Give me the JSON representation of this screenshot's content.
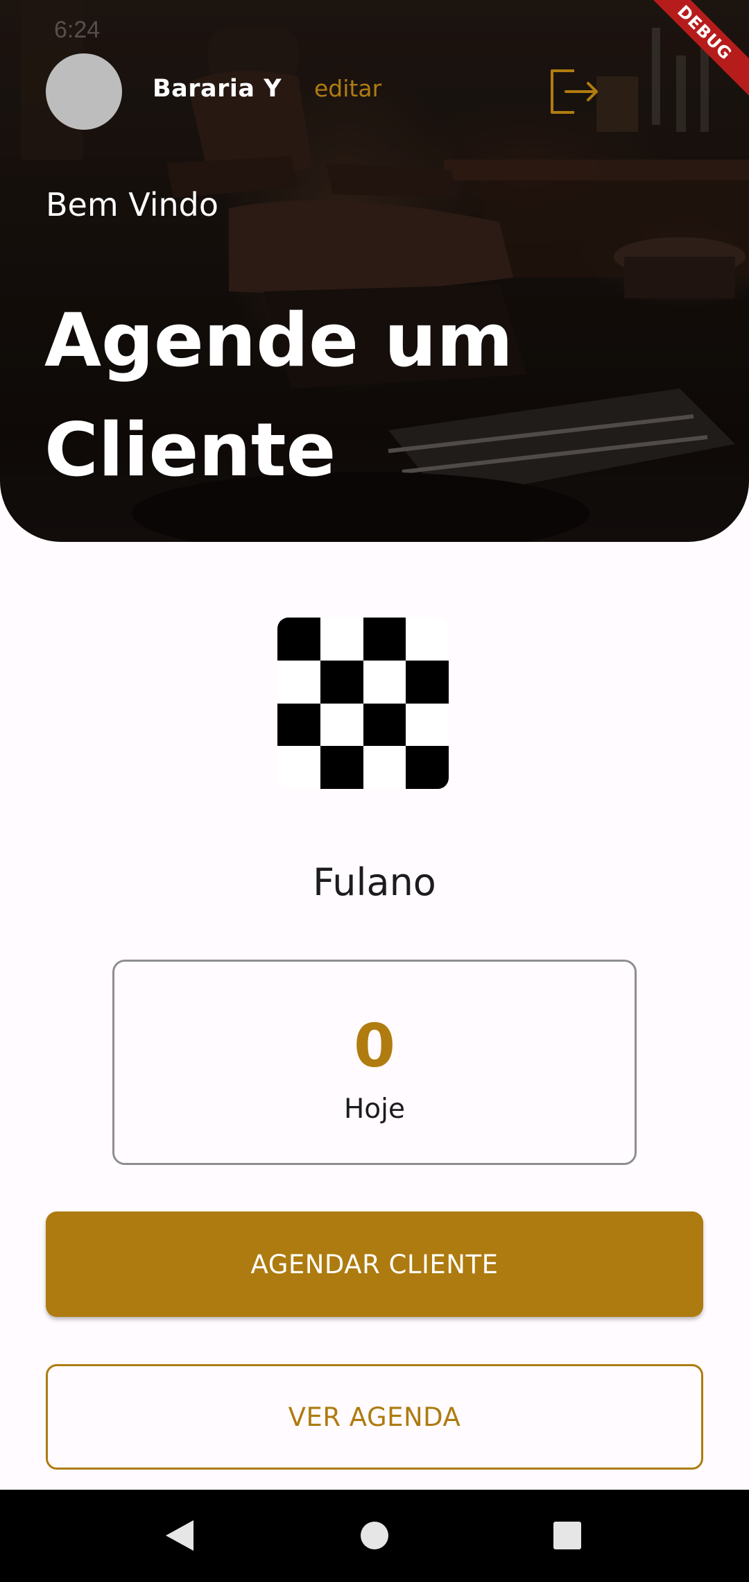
{
  "status_bar": {
    "time": "6:24"
  },
  "header": {
    "shop_name": "Bararia Y",
    "edit_label": "editar",
    "logout_icon": "logout-icon",
    "welcome": "Bem Vindo",
    "headline_line1": "Agende um",
    "headline_line2": "Cliente",
    "debug_banner": "DEBUG"
  },
  "client": {
    "name": "Fulano",
    "qr_icon": "qr-code"
  },
  "stats": {
    "value": "0",
    "label": "Hoje"
  },
  "actions": {
    "primary_label": "AGENDAR CLIENTE",
    "secondary_label": "VER AGENDA"
  },
  "colors": {
    "accent": "#ad7b0f",
    "background": "#fffbfe",
    "outline": "#8e8e8e",
    "debug": "#b71c1c"
  }
}
